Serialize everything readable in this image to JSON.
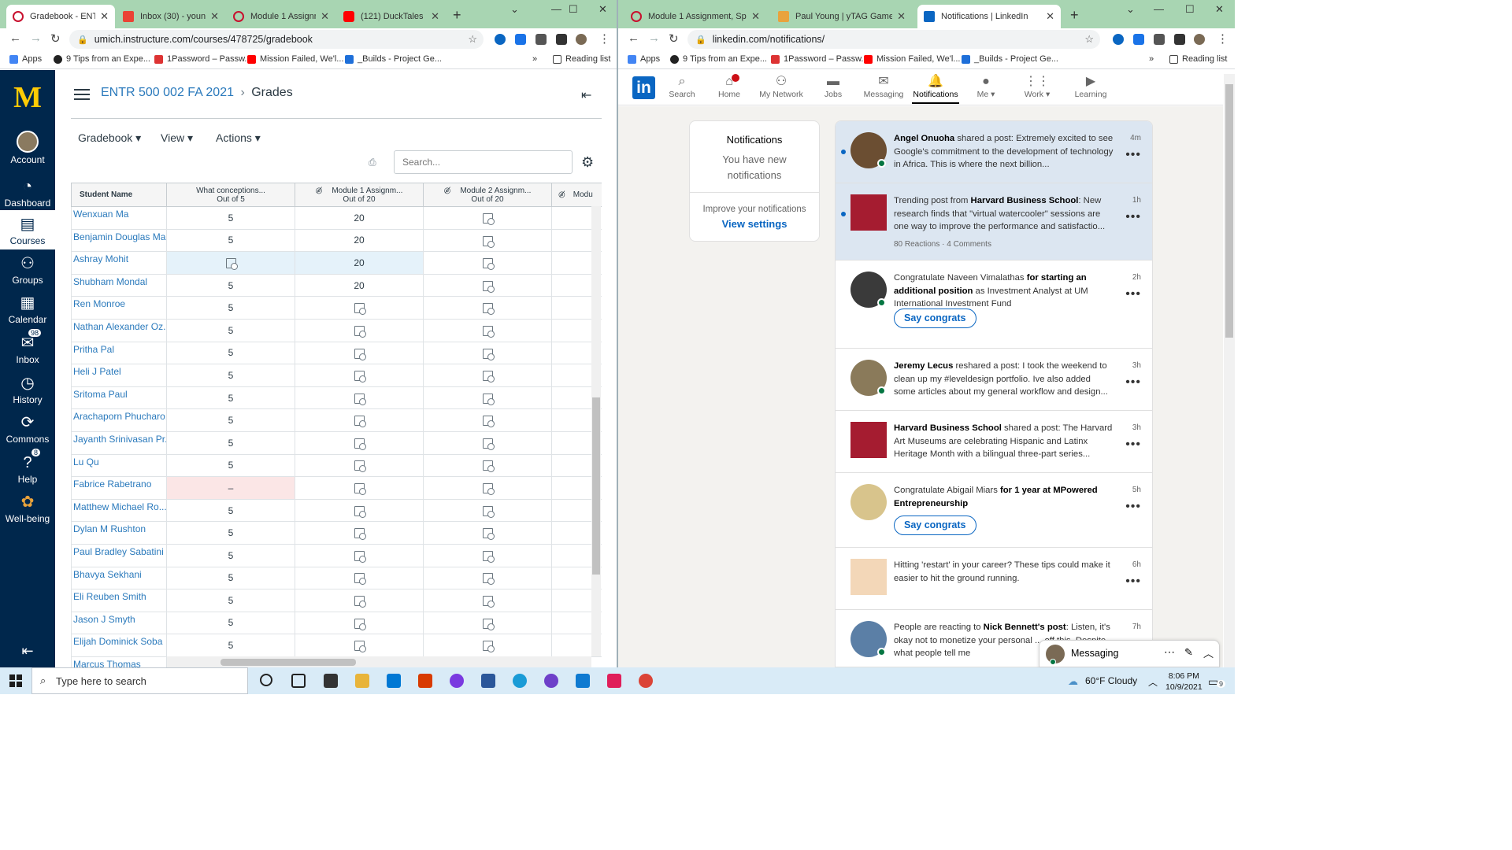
{
  "left_browser": {
    "tabs": [
      {
        "title": "Gradebook - ENTR 500 002 FA 2021",
        "color": "#c8102e",
        "active": true
      },
      {
        "title": "Inbox (30) - youngp",
        "color": "#ea4335",
        "active": false
      },
      {
        "title": "Module 1 Assignment",
        "color": "#c8102e",
        "active": false
      },
      {
        "title": "(121) DuckTales",
        "color": "#ff0000",
        "active": false
      }
    ],
    "url": "umich.instructure.com/courses/478725/gradebook",
    "bookmarks": [
      "Apps",
      "9 Tips from an Expe...",
      "1Password – Passw...",
      "Mission Failed, We'l...",
      "_Builds - Project Ge..."
    ],
    "more": "»",
    "reading_list": "Reading list"
  },
  "canvas": {
    "logo": "M",
    "nav": [
      {
        "label": "Account",
        "icon": "avatar-icon",
        "glyph": "●"
      },
      {
        "label": "Dashboard",
        "icon": "dashboard-icon",
        "glyph": "◔"
      },
      {
        "label": "Courses",
        "icon": "courses-icon",
        "glyph": "▤"
      },
      {
        "label": "Groups",
        "icon": "groups-icon",
        "glyph": "⚇"
      },
      {
        "label": "Calendar",
        "icon": "calendar-icon",
        "glyph": "▦"
      },
      {
        "label": "Inbox",
        "icon": "inbox-icon",
        "glyph": "✉",
        "badge": "98"
      },
      {
        "label": "History",
        "icon": "history-icon",
        "glyph": "◷"
      },
      {
        "label": "Commons",
        "icon": "commons-icon",
        "glyph": "⟳"
      },
      {
        "label": "Help",
        "icon": "help-icon",
        "glyph": "?",
        "badge": "8"
      },
      {
        "label": "Well-being",
        "icon": "wellbeing-icon",
        "glyph": "✿"
      }
    ],
    "breadcrumb_course": "ENTR 500 002 FA 2021",
    "breadcrumb_sep": "›",
    "breadcrumb_page": "Grades",
    "menus": [
      "Gradebook ▾",
      "View ▾",
      "Actions ▾"
    ],
    "search_placeholder": "Search...",
    "columns": [
      {
        "title": "Student Name",
        "sub": ""
      },
      {
        "title": "What conceptions...",
        "sub": "Out of 5"
      },
      {
        "title": "Module 1 Assignm...",
        "sub": "Out of 20"
      },
      {
        "title": "Module 2 Assignm...",
        "sub": "Out of 20"
      },
      {
        "title": "Modu",
        "sub": ""
      }
    ],
    "students": [
      {
        "name": "Wenxuan Ma",
        "c1": "5",
        "c2": "20",
        "c3": "icon"
      },
      {
        "name": "Benjamin Douglas Ma...",
        "c1": "5",
        "c2": "20",
        "c3": "icon"
      },
      {
        "name": "Ashray Mohit",
        "c1": "icon",
        "c2": "20",
        "c3": "icon",
        "highlight": true
      },
      {
        "name": "Shubham Mondal",
        "c1": "5",
        "c2": "20",
        "c3": "icon"
      },
      {
        "name": "Ren Monroe",
        "c1": "5",
        "c2": "icon",
        "c3": "icon"
      },
      {
        "name": "Nathan Alexander Oz...",
        "c1": "5",
        "c2": "icon",
        "c3": "icon"
      },
      {
        "name": "Pritha Pal",
        "c1": "5",
        "c2": "icon",
        "c3": "icon"
      },
      {
        "name": "Heli J Patel",
        "c1": "5",
        "c2": "icon",
        "c3": "icon"
      },
      {
        "name": "Sritoma Paul",
        "c1": "5",
        "c2": "icon",
        "c3": "icon"
      },
      {
        "name": "Arachaporn Phucharo...",
        "c1": "5",
        "c2": "icon",
        "c3": "icon"
      },
      {
        "name": "Jayanth Srinivasan Pr...",
        "c1": "5",
        "c2": "icon",
        "c3": "icon"
      },
      {
        "name": "Lu Qu",
        "c1": "5",
        "c2": "icon",
        "c3": "icon"
      },
      {
        "name": "Fabrice Rabetrano",
        "c1": "–",
        "c2": "icon",
        "c3": "icon",
        "missing": true
      },
      {
        "name": "Matthew Michael Ro...",
        "c1": "5",
        "c2": "icon",
        "c3": "icon"
      },
      {
        "name": "Dylan M Rushton",
        "c1": "5",
        "c2": "icon",
        "c3": "icon"
      },
      {
        "name": "Paul Bradley Sabatini",
        "c1": "5",
        "c2": "icon",
        "c3": "icon"
      },
      {
        "name": "Bhavya Sekhani",
        "c1": "5",
        "c2": "icon",
        "c3": "icon"
      },
      {
        "name": "Eli Reuben Smith",
        "c1": "5",
        "c2": "icon",
        "c3": "icon"
      },
      {
        "name": "Jason J Smyth",
        "c1": "5",
        "c2": "icon",
        "c3": "icon"
      },
      {
        "name": "Elijah Dominick Soba",
        "c1": "5",
        "c2": "icon",
        "c3": "icon"
      },
      {
        "name": "Marcus Thomas",
        "c1": "",
        "c2": "",
        "c3": ""
      }
    ]
  },
  "right_browser": {
    "tabs": [
      {
        "title": "Module 1 Assignment, SpeedC",
        "color": "#c8102e",
        "active": false
      },
      {
        "title": "Paul Young | yTAG Games",
        "color": "#e8a33d",
        "active": false
      },
      {
        "title": "Notifications | LinkedIn",
        "color": "#0a66c2",
        "active": true
      }
    ],
    "url": "linkedin.com/notifications/",
    "bookmarks": [
      "Apps",
      "9 Tips from an Expe...",
      "1Password – Passw...",
      "Mission Failed, We'l...",
      "_Builds - Project Ge..."
    ],
    "more": "»",
    "reading_list": "Reading list"
  },
  "linkedin": {
    "logo": "in",
    "nav": [
      {
        "label": "Search",
        "glyph": "⌕"
      },
      {
        "label": "Home",
        "glyph": "⌂"
      },
      {
        "label": "My Network",
        "glyph": "⚇"
      },
      {
        "label": "Jobs",
        "glyph": "▬"
      },
      {
        "label": "Messaging",
        "glyph": "✉"
      },
      {
        "label": "Notifications",
        "glyph": "🔔",
        "selected": true
      },
      {
        "label": "Me ▾",
        "glyph": "●"
      },
      {
        "label": "Work ▾",
        "glyph": "⋮⋮"
      },
      {
        "label": "Learning",
        "glyph": "▶"
      }
    ],
    "card": {
      "title": "Notifications",
      "subtitle": "You have new notifications",
      "improve": "Improve your notifications",
      "view_settings": "View settings"
    },
    "notifications": [
      {
        "bold": "Angel Onuoha",
        "text": " shared a post: Extremely excited to see Google's commitment to the development of technology in Africa. This is where the next billion...",
        "time": "4m",
        "unread": true,
        "avatar_color": "#6b4e32"
      },
      {
        "pre": "Trending post from ",
        "bold": "Harvard Business School",
        "text": ": New research finds that \"virtual watercooler\" sessions are one way to improve the performance and satisfactio...",
        "time": "1h",
        "unread": true,
        "meta": "80 Reactions  ·  4 Comments",
        "avatar_color": "#a51c30",
        "square": true
      },
      {
        "pre": "Congratulate Naveen Vimalathas ",
        "bold": "for starting an additional position",
        "text": " as Investment Analyst at UM International Investment Fund",
        "time": "2h",
        "button": "Say congrats",
        "avatar_color": "#3a3a3a"
      },
      {
        "bold": "Jeremy Lecus",
        "text": " reshared a post: I took the weekend to clean up my #leveldesign portfolio. Ive also added some articles about my general workflow and design...",
        "time": "3h",
        "avatar_color": "#8a7a5a"
      },
      {
        "bold": "Harvard Business School",
        "text": " shared a post: The Harvard Art Museums are celebrating Hispanic and Latinx Heritage Month with a bilingual three-part series...",
        "time": "3h",
        "avatar_color": "#a51c30",
        "square": true
      },
      {
        "pre": "Congratulate Abigail Miars ",
        "bold": "for 1 year at MPowered Entrepreneurship",
        "text": "",
        "time": "5h",
        "button": "Say congrats",
        "avatar_color": "#d8c48c"
      },
      {
        "pre": "Hitting 'restart' in your career? These tips could make it easier to hit the ground running.",
        "bold": "",
        "text": "",
        "time": "6h",
        "avatar_color": "#f3d7b8",
        "square": true
      },
      {
        "pre": "People are reacting to ",
        "bold": "Nick Bennett's post",
        "text": ": Listen, it's okay not to monetize your personal ... off this. Despite what people tell me",
        "time": "7h",
        "avatar_color": "#5b7fa6"
      }
    ],
    "messaging": "Messaging"
  },
  "taskbar": {
    "search_placeholder": "Type here to search",
    "weather": "60°F  Cloudy",
    "time": "8:06 PM",
    "date": "10/9/2021",
    "notif_count": "9"
  }
}
